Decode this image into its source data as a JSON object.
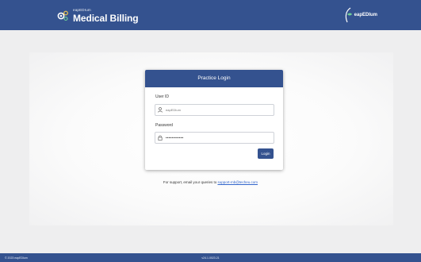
{
  "header": {
    "brand_small": "eapEDIum",
    "brand_title": "Medical Billing",
    "partner_logo_text": "eapEDIum"
  },
  "login": {
    "title": "Practice Login",
    "user_id_label": "User ID",
    "user_id_placeholder": "eapEDIum",
    "password_label": "Password",
    "password_value": "••••••••••••",
    "login_button": "Login"
  },
  "support": {
    "text": "For support, email your queries to",
    "email": "support-mb@techeu.com"
  },
  "footer": {
    "copyright": "© 2023 eapEDIum",
    "version": "v24.1.0023.21"
  },
  "colors": {
    "primary": "#34528f",
    "link": "#3366cc",
    "background": "#eeeeef"
  },
  "icons": {
    "brand": "gear-icon",
    "user_field": "user-icon",
    "password_field": "lock-icon",
    "partner": "leaf-logo-icon"
  }
}
